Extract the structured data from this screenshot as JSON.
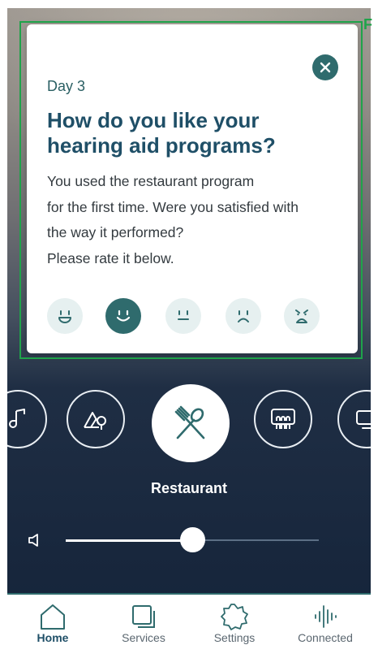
{
  "card": {
    "day": "Day 3",
    "question": "How do you like your hearing aid programs?",
    "lines": [
      "You used the restaurant program",
      "for the first time. Were you satisfied with",
      "the way it performed?",
      "Please rate it below."
    ],
    "ratings": [
      {
        "icon": "grinning-face-icon",
        "selected": false
      },
      {
        "icon": "smiling-face-icon",
        "selected": true
      },
      {
        "icon": "neutral-face-icon",
        "selected": false
      },
      {
        "icon": "frowning-face-icon",
        "selected": false
      },
      {
        "icon": "distressed-face-icon",
        "selected": false
      }
    ]
  },
  "programs": {
    "items": [
      "music-note-icon",
      "outdoor-icon",
      "restaurant-icon",
      "theater-icon",
      "tv-icon"
    ],
    "active": "restaurant-icon",
    "active_label": "Restaurant"
  },
  "volume": {
    "level": 0.5
  },
  "tabs": [
    {
      "label": "Home",
      "icon": "house-icon",
      "active": true
    },
    {
      "label": "Services",
      "icon": "services-icon",
      "active": false
    },
    {
      "label": "Settings",
      "icon": "gear-icon",
      "active": false
    },
    {
      "label": "Connected",
      "icon": "sound-wave-icon",
      "active": false
    }
  ],
  "colors": {
    "accent": "#2f6b6d",
    "title": "#1f4f67",
    "highlight": "#1fa34a"
  }
}
